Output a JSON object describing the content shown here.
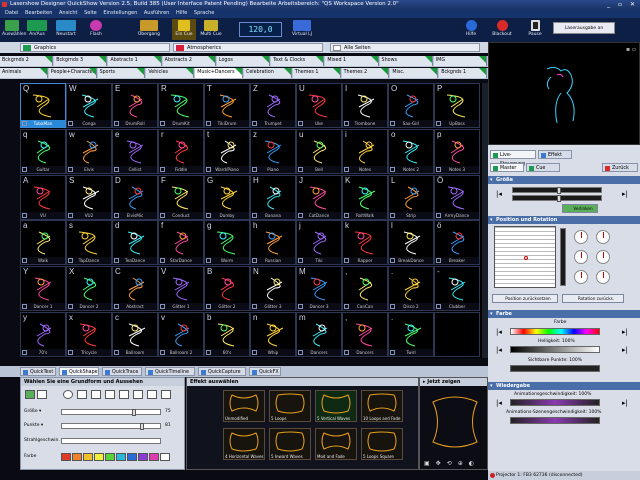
{
  "window": {
    "title": "Lasershow Designer QuickShow   Version 2.5, Build 385  (User Interface Patent Pending)   Bearbeite Arbeitsbereich: \"QS Workspace Version 2.0\"",
    "controls": "_ ▫ ✕"
  },
  "menu": [
    "Datei",
    "Bearbeiten",
    "Ansicht",
    "Seite",
    "Einstellungen",
    "Ausführen",
    "Hilfe",
    "Sprache"
  ],
  "toolbar": {
    "buttons": [
      "Auswählen",
      "An/Aus",
      "Neustart",
      "Flash",
      "Übergang",
      "Ein Cue",
      "Multi Cue",
      "Virtual LJ"
    ],
    "speed": "120,0",
    "right_buttons": [
      "Hilfe",
      "Blackout",
      "Pause",
      "Laserausgabe an"
    ]
  },
  "page_tabs": [
    "Graphics",
    "Atmospherics",
    "Alle Seiten"
  ],
  "tabs_row2": [
    "Bckgrnds 2",
    "Bckgrnds 3",
    "Abstracts 1",
    "Abstracts 2",
    "Logos",
    "Text & Clocks",
    "Mixed 1",
    "Shows",
    "IMG"
  ],
  "tabs_row3": [
    "Animals",
    "People+Characters",
    "Sports",
    "Vehicles",
    "Music+Dancers",
    "Celebration",
    "Themes 1",
    "Themes 2",
    "Misc.",
    "Bckgnds 1"
  ],
  "grid": {
    "keys": [
      [
        "Q",
        "W",
        "E",
        "R",
        "T",
        "Z",
        "U",
        "I",
        "O",
        "P"
      ],
      [
        "q",
        "w",
        "e",
        "r",
        "t",
        "z",
        "u",
        "i",
        "o",
        "p"
      ],
      [
        "A",
        "S",
        "D",
        "F",
        "G",
        "H",
        "J",
        "K",
        "L",
        "Ö"
      ],
      [
        "a",
        "s",
        "d",
        "f",
        "g",
        "h",
        "j",
        "k",
        "l",
        "ö"
      ],
      [
        "Y",
        "X",
        "C",
        "V",
        "B",
        "N",
        "M",
        ",",
        ".",
        "-"
      ],
      [
        "y",
        "x",
        "c",
        "v",
        "b",
        "n",
        "m",
        ",",
        ".",
        ""
      ]
    ],
    "names": [
      [
        "TubaMan",
        "Conga",
        "DrumRoll",
        "DrumKit",
        "TikiDrum",
        "Trumpet",
        "Uke",
        "Trombone",
        "Sax-Girl",
        "UpBass"
      ],
      [
        "Guitar",
        "Elvis",
        "Cellist",
        "Fiddle",
        "Ward/Piano",
        "Piano",
        "Bell",
        "Notes",
        "Notes 2",
        "Notes 3"
      ],
      [
        "VU",
        "VU2",
        "ElvisMic",
        "Conduct",
        "Dumby",
        "Banana",
        "CatDance",
        "RoltWalk",
        "Strip",
        "ArmyDance"
      ],
      [
        "Walk",
        "TapDance",
        "TeaDance",
        "StarDance",
        "Worm",
        "Russian",
        "Tiki",
        "Rapper",
        "BreakDance",
        "Breaker"
      ],
      [
        "Dancer 1",
        "Dancer 2",
        "Abstract",
        "Glitter 1",
        "Glitter 2",
        "Glitter 3",
        "Dancer 3",
        "CanCan",
        "Disco 2",
        "Clubber"
      ],
      [
        "70's",
        "Tricycle",
        "Ballroom",
        "Ballroom 2",
        "60's",
        "Whip",
        "Dancers",
        "Dancers",
        "Twirl",
        ""
      ]
    ],
    "colors": [
      "#ffd23a",
      "#3af0ff",
      "#ff4aa0",
      "#4aff6a",
      "#ffa03a",
      "#a06aff",
      "#ff3a3a",
      "#ffffff",
      "#3aa0ff",
      "#ffea6a"
    ]
  },
  "mode_tabs": [
    "QuickText",
    "QuickShape",
    "QuickTrace",
    "QuickTimeline",
    "QuickCapture",
    "QuickFX"
  ],
  "left_panel": {
    "header": "Wählen Sie eine Grundform und Aussehen",
    "rows": [
      {
        "label": "Größe ▾",
        "value": "75"
      },
      {
        "label": "Punkte ▾",
        "value": "81"
      },
      {
        "label": "Strahlgeschwin.",
        "value": ""
      },
      {
        "label": "Farbe",
        "value": ""
      }
    ],
    "palette": [
      "#e03a2a",
      "#f0802a",
      "#f0c02a",
      "#f0f03a",
      "#5ad03a",
      "#2ab8d8",
      "#2a6ad8",
      "#8a3ad8",
      "#e03ab0",
      "#ffffff"
    ]
  },
  "effects": {
    "header": "Effekt auswählen",
    "items": [
      "Unmodified",
      "5 Loops",
      "5 Vertical Waves",
      "10 Loops and Fade",
      "4 Horizontal Waves",
      "5 Inward Waves",
      "Mod and Fade",
      "5 Loops Square"
    ]
  },
  "preview": {
    "header": "▸ Jetzt zeigen"
  },
  "right": {
    "live_tabs": [
      "Live-Steuerung",
      "Effekt"
    ],
    "subtabs": [
      "Master",
      "Cue",
      "Zurück"
    ],
    "sections": {
      "groesse": "Größe",
      "groesse_btn": "Verlinken",
      "pos": "Position und Rotation",
      "pos_btn1": "Position zurücksetzen",
      "pos_btn2": "Rotation zurücks.",
      "farbe": "Farbe",
      "farbe_label": "Farbe",
      "helligkeit": "Helligkeit: 100%",
      "sichtbare": "Sichtbare Punkte: 100%",
      "wiedergabe": "Wiedergabe",
      "anim1": "Animationsgeschwindigkeit: 100%",
      "anim2": "Animations-Szenengeschwindigkeit: 100%"
    },
    "status": "Projector 1: FB3 62736 (disconnected)"
  }
}
